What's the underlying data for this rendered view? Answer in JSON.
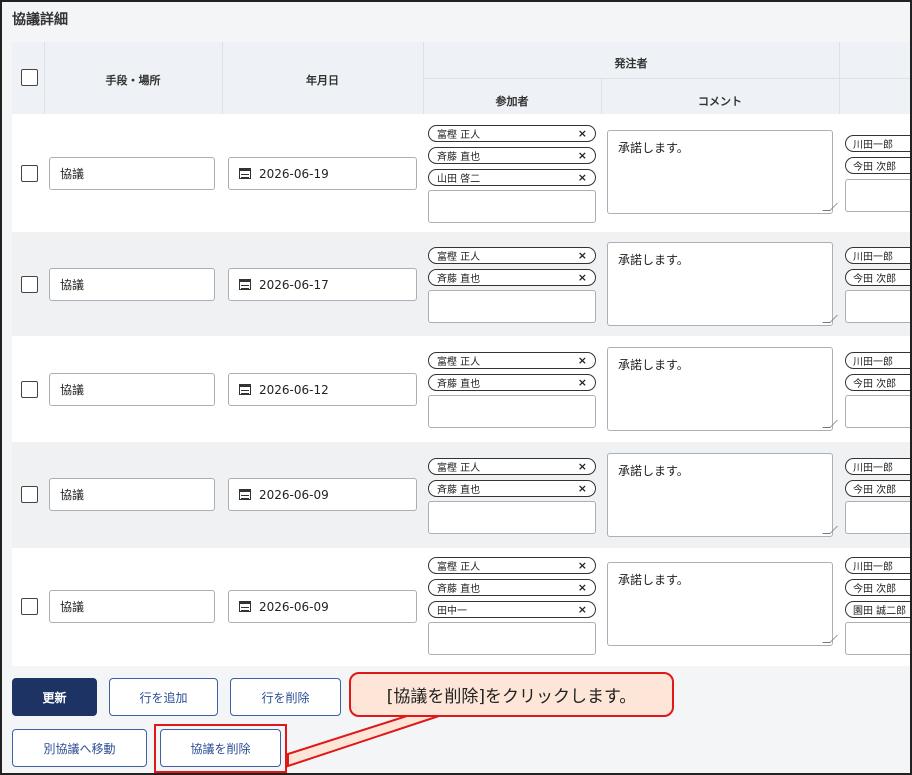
{
  "section_title": "協議詳細",
  "table": {
    "headers": {
      "method_place": "手段・場所",
      "date": "年月日",
      "issuer_group": "発注者",
      "participants": "参加者",
      "comment": "コメント"
    },
    "rows": [
      {
        "method": "協議",
        "date": "2026-06-19",
        "participants": [
          "富樫 正人",
          "斉藤 直也",
          "山田 啓二"
        ],
        "comment": "承諾します。",
        "contractor_participants": [
          "川田一郎",
          "今田 次郎"
        ]
      },
      {
        "method": "協議",
        "date": "2026-06-17",
        "participants": [
          "富樫 正人",
          "斉藤 直也"
        ],
        "comment": "承諾します。",
        "contractor_participants": [
          "川田一郎",
          "今田 次郎"
        ]
      },
      {
        "method": "協議",
        "date": "2026-06-12",
        "participants": [
          "富樫 正人",
          "斉藤 直也"
        ],
        "comment": "承諾します。",
        "contractor_participants": [
          "川田一郎",
          "今田 次郎"
        ]
      },
      {
        "method": "協議",
        "date": "2026-06-09",
        "participants": [
          "富樫 正人",
          "斉藤 直也"
        ],
        "comment": "承諾します。",
        "contractor_participants": [
          "川田一郎",
          "今田 次郎"
        ]
      },
      {
        "method": "協議",
        "date": "2026-06-09",
        "participants": [
          "富樫 正人",
          "斉藤 直也",
          "田中一"
        ],
        "comment": "承諾します。",
        "contractor_participants": [
          "川田一郎",
          "今田 次郎",
          "園田 誠二郎"
        ]
      }
    ],
    "chip_remove_glyph": "×"
  },
  "buttons": {
    "update": "更新",
    "add_row": "行を追加",
    "delete_row": "行を削除",
    "move_other": "別協議へ移動",
    "delete_kyogi": "協議を削除"
  },
  "callout": "[協議を削除]をクリックします。",
  "colors": {
    "primary": "#1d3364",
    "highlight": "#e01818",
    "callout_bg": "#fde6d8"
  }
}
